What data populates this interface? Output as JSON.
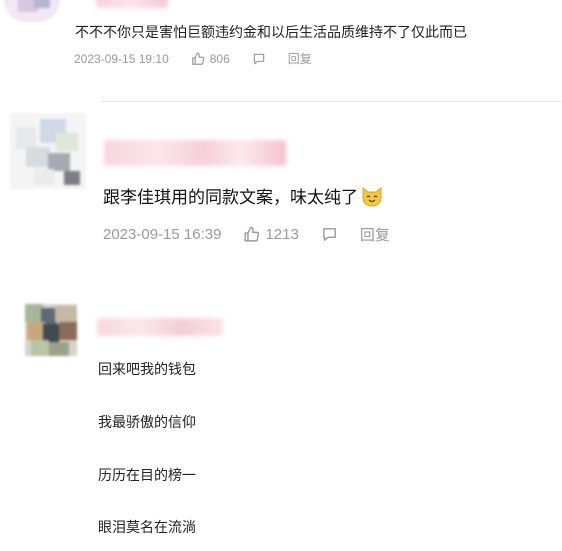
{
  "comments": [
    {
      "text": "不不不你只是害怕巨额违约金和以后生活品质维持不了仅此而已",
      "timestamp": "2023-09-15 19:10",
      "likes": "806",
      "reply_label": "回复"
    },
    {
      "text": "跟李佳琪用的同款文案，味太纯了",
      "emoji_icon": "cat-smile-emoji-icon",
      "timestamp": "2023-09-15 16:39",
      "likes": "1213",
      "reply_label": "回复"
    },
    {
      "lines": [
        "回来吧我的钱包",
        "我最骄傲的信仰",
        "历历在目的榜一",
        "眼泪莫名在流淌"
      ]
    }
  ],
  "colors": {
    "meta_text": "#9a9a9a",
    "divider": "#e6e6e6",
    "blurred_name": "#f7d3dc"
  }
}
